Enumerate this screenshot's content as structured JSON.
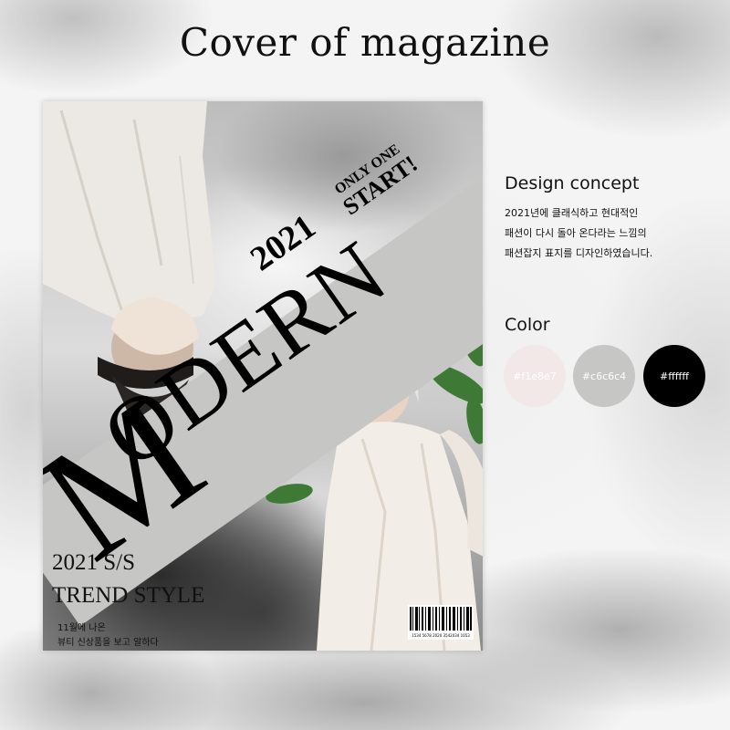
{
  "title": "Cover of magazine",
  "cover": {
    "headline": "ODERN",
    "headline_initial": "M",
    "tagline_year": "2021",
    "tagline_only_one": "ONLY ONE",
    "tagline_start": "START!",
    "season": "2021 S/S",
    "trend": "TREND STYLE",
    "small_line_1": "11월에 나온",
    "small_line_2": "뷰티 신상품을 보고 알하다",
    "barcode_number": "1534 5678 2020 3542034 1053"
  },
  "concept": {
    "heading": "Design concept",
    "lines": [
      "2021년에 클래식하고 현대적인",
      "패션이 다시 돌아 온다라는 느낌의",
      "패션잡지 표지를 디자인하였습니다."
    ]
  },
  "color_section": {
    "heading": "Color",
    "swatches": [
      {
        "label": "#f1e8e7",
        "color": "#f1e8e7",
        "text_color": "#ffffff"
      },
      {
        "label": "#c6c6c4",
        "color": "#c6c6c4",
        "text_color": "#ffffff"
      },
      {
        "label": "#ffffff",
        "color": "#000000",
        "text_color": "#ffffff"
      }
    ]
  }
}
